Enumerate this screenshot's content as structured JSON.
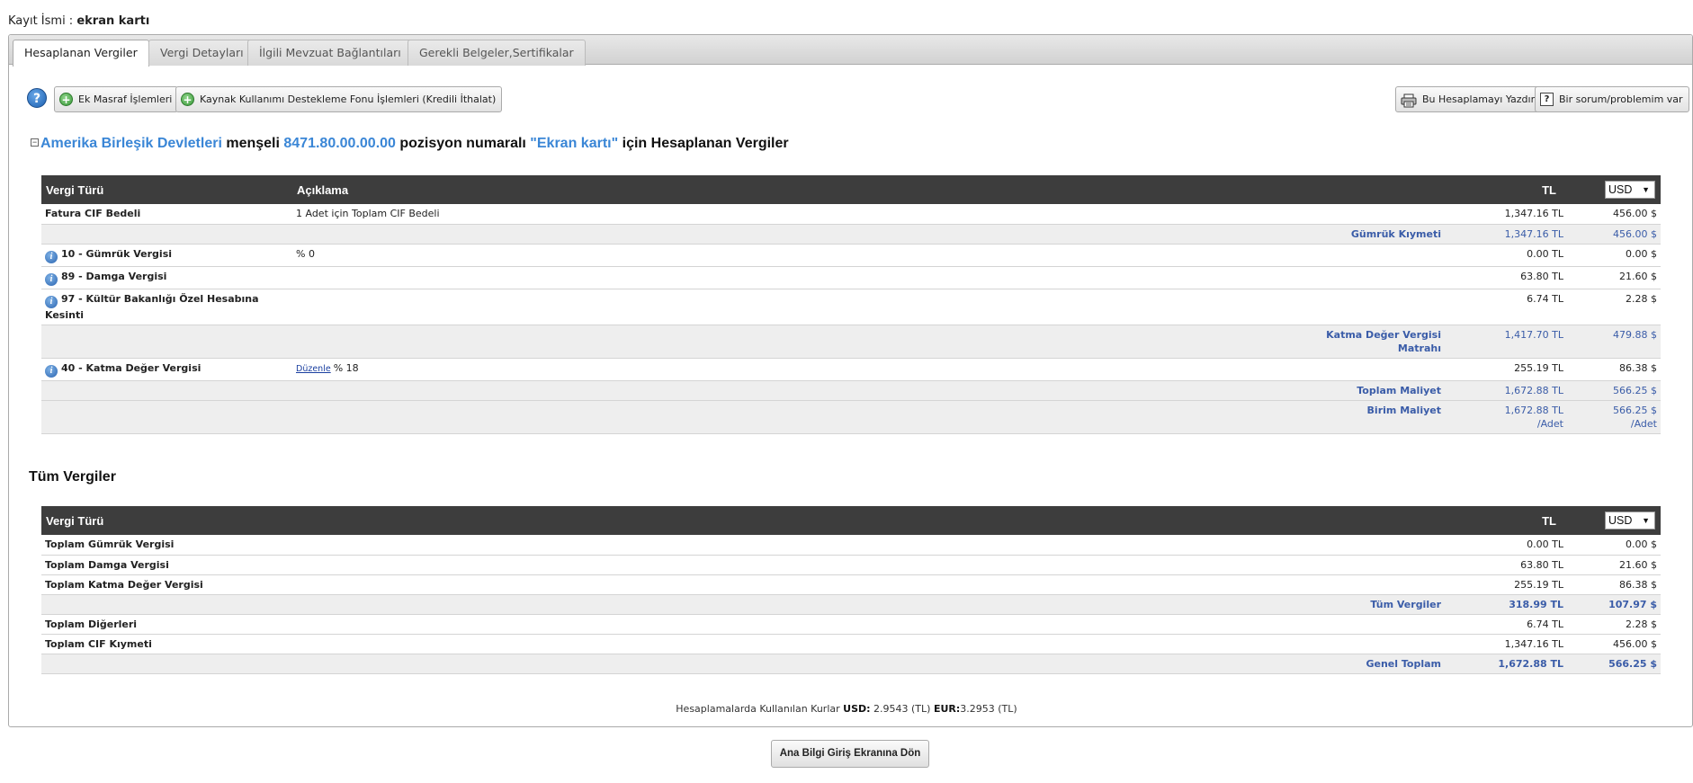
{
  "record": {
    "label": "Kayıt İsmi :",
    "value": "ekran kartı"
  },
  "tabs": [
    {
      "label": "Hesaplanan Vergiler",
      "active": true
    },
    {
      "label": "Vergi Detayları",
      "active": false
    },
    {
      "label": "İlgili Mevzuat Bağlantıları",
      "active": false
    },
    {
      "label": "Gerekli Belgeler,Sertifikalar",
      "active": false
    }
  ],
  "toolbar": {
    "help": "?",
    "extra_expense": "Ek Masraf İşlemleri",
    "kkdf": "Kaynak Kullanımı Destekleme Fonu İşlemleri (Kredili İthalat)",
    "print": "Bu Hesaplamayı Yazdır",
    "question": "Bir sorum/problemim var",
    "q_mark": "?"
  },
  "heading": {
    "collapse": "−",
    "country": "Amerika Birleşik Devletleri",
    "t1": " menşeli ",
    "code": "8471.80.00.00.00",
    "t2": " pozisyon numaralı ",
    "product": "\"Ekran kartı\"",
    "t3": " için Hesaplanan Vergiler"
  },
  "calc_table": {
    "headers": {
      "type": "Vergi Türü",
      "desc": "Açıklama",
      "tl": "TL",
      "currency": "USD"
    },
    "rows": [
      {
        "name": "Fatura CIF Bedeli",
        "desc": "1 Adet için Toplam CIF Bedeli",
        "tl": "1,347.16 TL",
        "usd": "456.00 $"
      },
      {
        "sub": "Gümrük Kıymeti",
        "tl": "1,347.16 TL",
        "usd": "456.00 $"
      },
      {
        "name": "10 - Gümrük Vergisi",
        "desc": "% 0",
        "tl": "0.00 TL",
        "usd": "0.00 $"
      },
      {
        "name": "89 - Damga Vergisi",
        "desc": "",
        "tl": "63.80 TL",
        "usd": "21.60 $"
      },
      {
        "name": "97 - Kültür Bakanlığı Özel Hesabına Kesinti",
        "desc": "",
        "tl": "6.74 TL",
        "usd": "2.28 $"
      },
      {
        "sub": "Katma Değer Vergisi Matrahı",
        "tl": "1,417.70 TL",
        "usd": "479.88 $"
      },
      {
        "name": "40 - Katma Değer Vergisi",
        "edit": "Düzenle",
        "desc": "% 18",
        "tl": "255.19 TL",
        "usd": "86.38 $"
      },
      {
        "sub": "Toplam Maliyet",
        "tl": "1,672.88 TL",
        "usd": "566.25 $"
      },
      {
        "sub": "Birim Maliyet",
        "tl": "1,672.88 TL",
        "tl_unit": "/Adet",
        "usd": "566.25 $",
        "usd_unit": "/Adet"
      }
    ]
  },
  "all_taxes": {
    "title": "Tüm Vergiler",
    "headers": {
      "type": "Vergi Türü",
      "tl": "TL",
      "currency": "USD"
    },
    "rows": [
      {
        "name": "Toplam Gümrük Vergisi",
        "tl": "0.00 TL",
        "usd": "0.00 $"
      },
      {
        "name": "Toplam Damga Vergisi",
        "tl": "63.80 TL",
        "usd": "21.60 $"
      },
      {
        "name": "Toplam Katma Değer Vergisi",
        "tl": "255.19 TL",
        "usd": "86.38 $"
      },
      {
        "sub": "Tüm Vergiler",
        "tl": "318.99 TL",
        "usd": "107.97 $"
      },
      {
        "name": "Toplam Diğerleri",
        "tl": "6.74 TL",
        "usd": "2.28 $"
      },
      {
        "name": "Toplam CIF Kıymeti",
        "tl": "1,347.16 TL",
        "usd": "456.00 $"
      },
      {
        "sub": "Genel Toplam",
        "tl": "1,672.88 TL",
        "usd": "566.25 $"
      }
    ]
  },
  "rates": {
    "prefix": "Hesaplamalarda Kullanılan Kurlar",
    "usd_label": "USD:",
    "usd_value": "2.9543 (TL)",
    "eur_label": "EUR:",
    "eur_value": "3.2953 (TL)"
  },
  "back_button": "Ana Bilgi Giriş Ekranına Dön"
}
